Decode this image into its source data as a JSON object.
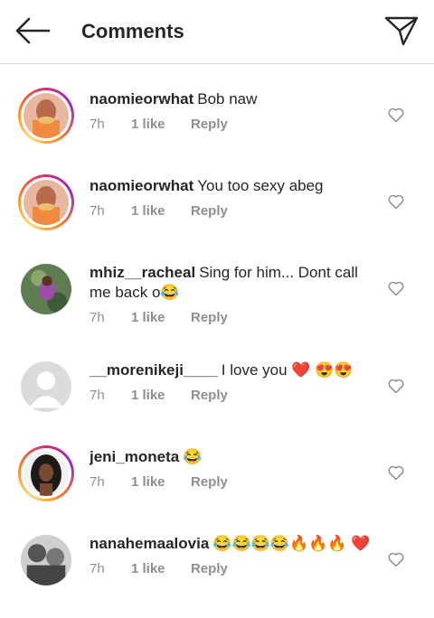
{
  "header": {
    "title": "Comments",
    "back_icon": "arrow-left-icon",
    "send_icon": "paper-plane-icon"
  },
  "comments": [
    {
      "user": "naomieorwhat",
      "text": "Bob naw",
      "time": "7h",
      "likes": "1 like",
      "reply": "Reply",
      "avatar": "naomie-avatar",
      "ring": true
    },
    {
      "user": "naomieorwhat",
      "text": "You too sexy abeg",
      "time": "7h",
      "likes": "1 like",
      "reply": "Reply",
      "avatar": "naomie-avatar",
      "ring": true
    },
    {
      "user": "mhiz__racheal",
      "text": "Sing for him... Dont call me back o😂",
      "time": "7h",
      "likes": "1 like",
      "reply": "Reply",
      "avatar": "racheal-avatar",
      "ring": false
    },
    {
      "user": "__morenikeji____",
      "text": "I love you ❤️ 😍😍",
      "time": "7h",
      "likes": "1 like",
      "reply": "Reply",
      "avatar": "default-avatar",
      "ring": false
    },
    {
      "user": "jeni_moneta",
      "text": "😂",
      "time": "7h",
      "likes": "1 like",
      "reply": "Reply",
      "avatar": "jeni-avatar",
      "ring": true
    },
    {
      "user": "nanahemaalovia",
      "text": "😂😂😂😂🔥🔥🔥 ❤️",
      "time": "7h",
      "likes": "1 like",
      "reply": "Reply",
      "avatar": "nana-avatar",
      "ring": false
    }
  ],
  "colors": {
    "muted": "#8e8e8e",
    "text": "#262626",
    "divider": "#dbdbdb"
  }
}
